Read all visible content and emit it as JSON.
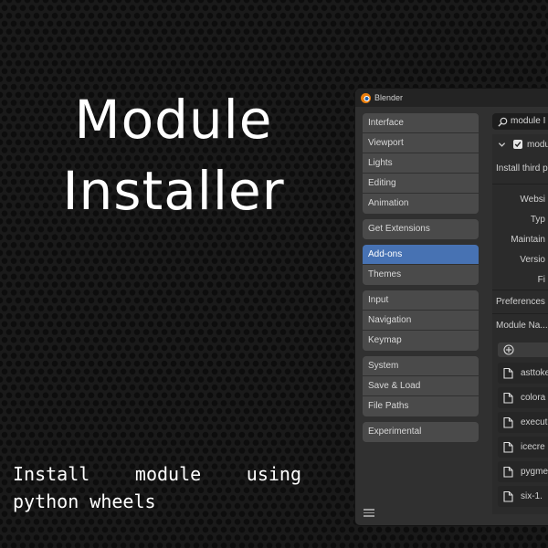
{
  "hero": {
    "title_line1": "Module",
    "title_line2": "Installer",
    "subtitle": "Install module using python wheels"
  },
  "window": {
    "title": "Blender",
    "logo_icon": "blender-logo"
  },
  "nav": {
    "groups": [
      [
        "Interface",
        "Viewport",
        "Lights",
        "Editing",
        "Animation"
      ],
      [
        "Get Extensions"
      ],
      [
        "Add-ons",
        "Themes"
      ],
      [
        "Input",
        "Navigation",
        "Keymap"
      ],
      [
        "System",
        "Save & Load",
        "File Paths"
      ],
      [
        "Experimental"
      ]
    ],
    "items": {
      "interface": "Interface",
      "viewport": "Viewport",
      "lights": "Lights",
      "editing": "Editing",
      "animation": "Animation",
      "get_extensions": "Get Extensions",
      "addons": "Add-ons",
      "themes": "Themes",
      "input": "Input",
      "navigation": "Navigation",
      "keymap": "Keymap",
      "system": "System",
      "save_load": "Save & Load",
      "file_paths": "File Paths",
      "experimental": "Experimental"
    },
    "active": "Add-ons"
  },
  "search": {
    "value": "module I",
    "icon": "search-icon"
  },
  "addon": {
    "name": "modu",
    "enabled": true,
    "description": "Install third p",
    "info_labels": [
      "Websi",
      "Typ",
      "Maintain",
      "Versio",
      "Fi"
    ],
    "preferences_label": "Preferences",
    "module_name_header": "Module Na...",
    "modules": [
      "asttoke",
      "colora",
      "execut",
      "icecre",
      "pygme",
      "six-1."
    ]
  },
  "colors": {
    "accent": "#4772b3",
    "panel_bg": "#303030",
    "button_bg": "#4a4a4a",
    "text": "#d8d8d8"
  }
}
